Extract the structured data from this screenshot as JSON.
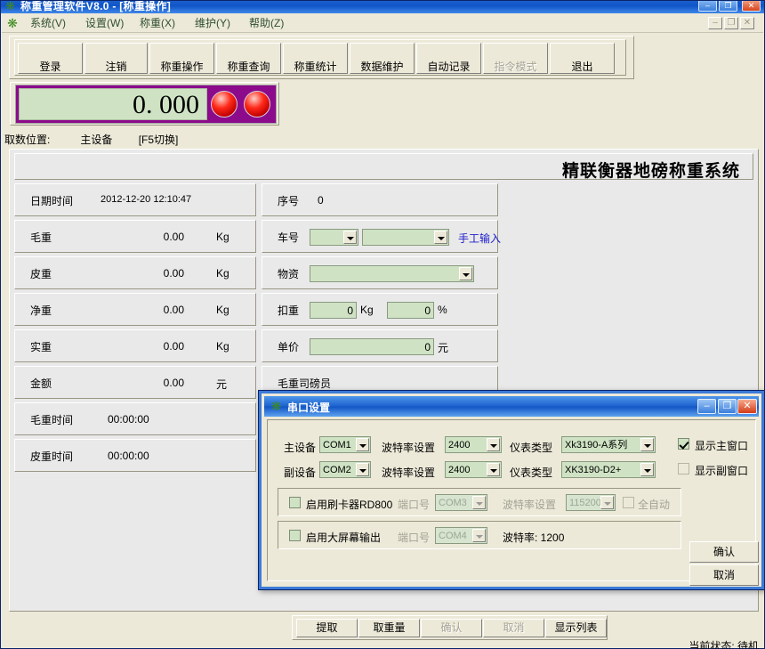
{
  "app": {
    "title": "称重管理软件V8.0  - [称重操作]",
    "icon": "clover-icon",
    "controls": {
      "minimize": "–",
      "maximize": "❐",
      "close": "✕"
    },
    "mdi_controls": {
      "minimize": "–",
      "restore": "❐",
      "close": "✕"
    }
  },
  "menubar": {
    "logo": "clover-icon",
    "items": [
      {
        "label": "系统(V)"
      },
      {
        "label": "设置(W)"
      },
      {
        "label": "称重(X)"
      },
      {
        "label": "维护(Y)"
      },
      {
        "label": "帮助(Z)"
      }
    ]
  },
  "toolbar": {
    "buttons": [
      {
        "label": "登录",
        "disabled": false
      },
      {
        "label": "注销",
        "disabled": false
      },
      {
        "label": "称重操作",
        "disabled": false
      },
      {
        "label": "称重查询",
        "disabled": false
      },
      {
        "label": "称重统计",
        "disabled": false
      },
      {
        "label": "数据维护",
        "disabled": false
      },
      {
        "label": "自动记录",
        "disabled": false
      },
      {
        "label": "指令模式",
        "disabled": true
      },
      {
        "label": "退出",
        "disabled": false
      }
    ]
  },
  "weight_display": {
    "value": "0. 000",
    "led_left": "indicator-led-red",
    "led_right": "indicator-led-red",
    "panel_color": "#8b0b8b",
    "lcd_color": "#cfe3c4"
  },
  "pick_position": {
    "label": "取数位置:",
    "device": "主设备",
    "hotkey": "[F5切换]"
  },
  "form": {
    "heading": "精联衡器地磅称重系统",
    "left_rows": [
      {
        "label": "日期时间",
        "value": "2012-12-20 12:10:47",
        "unit": ""
      },
      {
        "label": "毛重",
        "value": "0.00",
        "unit": "Kg"
      },
      {
        "label": "皮重",
        "value": "0.00",
        "unit": "Kg"
      },
      {
        "label": "净重",
        "value": "0.00",
        "unit": "Kg"
      },
      {
        "label": "实重",
        "value": "0.00",
        "unit": "Kg"
      },
      {
        "label": "金额",
        "value": "0.00",
        "unit": "元"
      },
      {
        "label": "毛重时间",
        "value": "00:00:00",
        "unit": ""
      },
      {
        "label": "皮重时间",
        "value": "00:00:00",
        "unit": ""
      }
    ],
    "right": {
      "serial": {
        "label": "序号",
        "value": "0"
      },
      "car": {
        "label": "车号",
        "combo1": "",
        "combo2": "",
        "manual_link": "手工输入"
      },
      "goods": {
        "label": "物资",
        "value": ""
      },
      "deduct": {
        "label": "扣重",
        "kg_value": "0",
        "kg_unit": "Kg",
        "pct_value": "0",
        "pct_unit": "%"
      },
      "price": {
        "label": "单价",
        "value": "0",
        "unit": "元"
      },
      "operator": {
        "label": "毛重司磅员"
      }
    }
  },
  "bottom_buttons": [
    {
      "label": "提取",
      "disabled": false
    },
    {
      "label": "取重量",
      "disabled": false
    },
    {
      "label": "确认",
      "disabled": true
    },
    {
      "label": "取消",
      "disabled": true
    },
    {
      "label": "显示列表",
      "disabled": false
    }
  ],
  "status": {
    "text": "当前状态: 待机"
  },
  "dialog": {
    "title": "串口设置",
    "icon": "clover-icon",
    "controls": {
      "minimize": "–",
      "maximize": "❐",
      "close": "✕"
    },
    "row1": {
      "device_label": "主设备",
      "device_value": "COM1",
      "baud_label": "波特率设置",
      "baud_value": "2400",
      "meter_label": "仪表类型",
      "meter_value": "Xk3190-A系列",
      "checkbox_label": "显示主窗口",
      "checkbox_checked": true
    },
    "row2": {
      "device_label": "副设备",
      "device_value": "COM2",
      "baud_label": "波特率设置",
      "baud_value": "2400",
      "meter_label": "仪表类型",
      "meter_value": "XK3190-D2+",
      "checkbox_label": "显示副窗口",
      "checkbox_checked": false
    },
    "card_reader": {
      "enable_label": "启用刷卡器RD800",
      "enabled": false,
      "port_label": "端口号",
      "port_value": "COM3",
      "baud_label": "波特率设置",
      "baud_value": "115200",
      "auto_label": "全自动",
      "auto_checked": false
    },
    "big_screen": {
      "enable_label": "启用大屏幕输出",
      "enabled": false,
      "port_label": "端口号",
      "port_value": "COM4",
      "baud_text": "波特率: 1200"
    },
    "ok_label": "确认",
    "cancel_label": "取消"
  }
}
